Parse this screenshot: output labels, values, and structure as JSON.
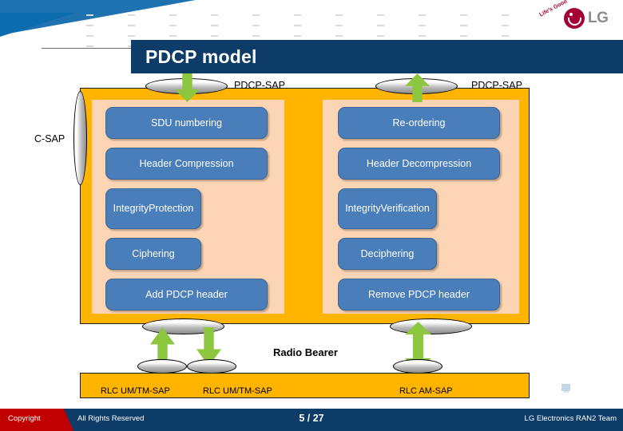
{
  "slide": {
    "title": "PDCP model",
    "brand": {
      "name": "LG",
      "tagline": "Life's Good"
    }
  },
  "diagram": {
    "top_sap_left_label": "PDCP-SAP",
    "top_sap_right_label": "PDCP-SAP",
    "control_sap_label": "C-SAP",
    "radio_bearer_label": "Radio Bearer",
    "transmit_chain": [
      {
        "label": "SDU numbering"
      },
      {
        "label": "Header Compression"
      },
      {
        "label": "Integrity\nProtection"
      },
      {
        "label": "Ciphering"
      },
      {
        "label": "Add PDCP header"
      }
    ],
    "receive_chain": [
      {
        "label": "Re-ordering"
      },
      {
        "label": "Header Decompression"
      },
      {
        "label": "Integrity\nVerification"
      },
      {
        "label": "Deciphering"
      },
      {
        "label": "Remove PDCP header"
      }
    ],
    "rlc_saps": [
      {
        "label": "RLC UM/TM-SAP"
      },
      {
        "label": "RLC UM/TM-SAP"
      },
      {
        "label": "RLC AM-SAP"
      }
    ]
  },
  "footer": {
    "copyright": "Copyright",
    "rights": "All Rights Reserved",
    "page": "5 / 27",
    "team": "LG Electronics RAN2 Team"
  },
  "colors": {
    "title_bar": "#0d3c68",
    "frame_orange": "#ffb400",
    "panel_peach": "#fcd5b4",
    "box_blue": "#4a7ebb",
    "arrow_green": "#8dc63f",
    "footer_navy": "#0d3c68",
    "copyright_red": "#c00000",
    "lg_crimson": "#a50034"
  }
}
